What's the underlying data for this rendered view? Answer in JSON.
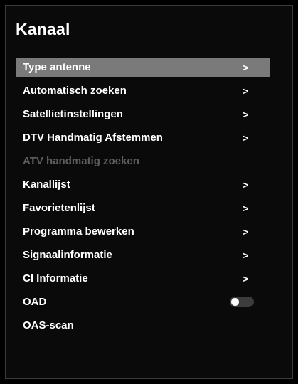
{
  "page": {
    "title": "Kanaal"
  },
  "menu": {
    "items": [
      {
        "label": "Type antenne",
        "arrow": ">"
      },
      {
        "label": "Automatisch zoeken",
        "arrow": ">"
      },
      {
        "label": "Satellietinstellingen",
        "arrow": ">"
      },
      {
        "label": "DTV Handmatig Afstemmen",
        "arrow": ">"
      },
      {
        "label": "ATV handmatig zoeken"
      },
      {
        "label": "Kanallijst",
        "arrow": ">"
      },
      {
        "label": "Favorietenlijst",
        "arrow": ">"
      },
      {
        "label": "Programma bewerken",
        "arrow": ">"
      },
      {
        "label": "Signaalinformatie",
        "arrow": ">"
      },
      {
        "label": "CI Informatie",
        "arrow": ">"
      },
      {
        "label": "OAD",
        "toggle": "off"
      },
      {
        "label": "OAS-scan"
      }
    ],
    "selected": "Type antenne",
    "disabled": "ATV handmatig zoeken"
  },
  "icons": {
    "arrow": "chevron-right-icon",
    "toggle": "toggle-switch-off-icon"
  },
  "colors": {
    "background": "#000000",
    "selected_row": "#7a7a7a",
    "disabled_text": "#5e5e5e",
    "text": "#ffffff"
  }
}
